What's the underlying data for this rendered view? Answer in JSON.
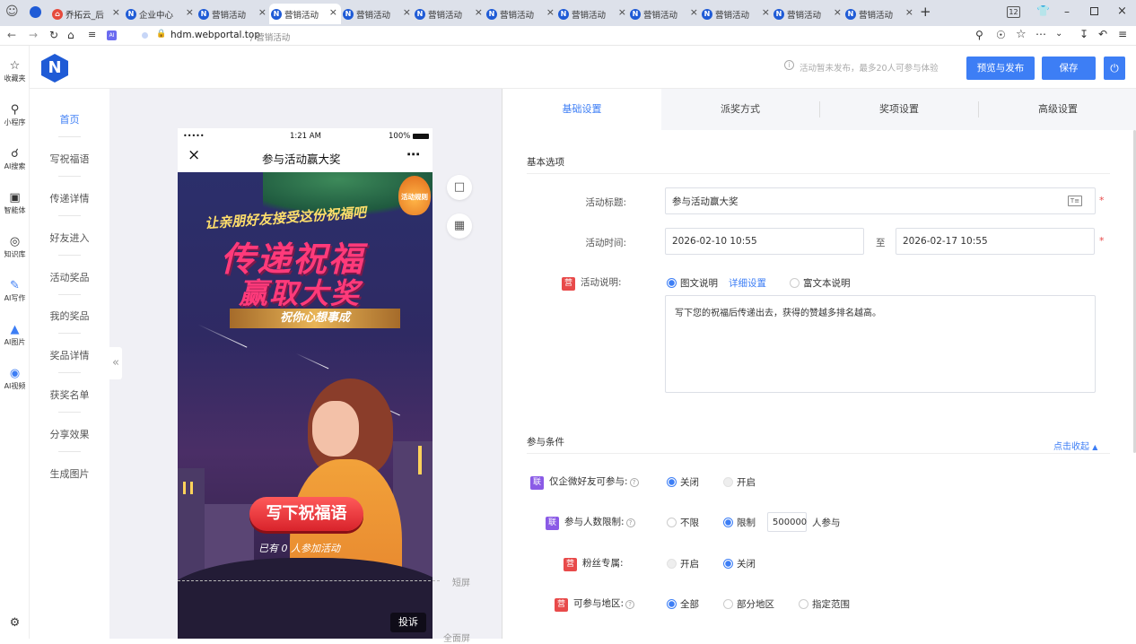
{
  "browser": {
    "tabs": [
      {
        "label": "乔拓云_后"
      },
      {
        "label": "企业中心"
      },
      {
        "label": "营销活动"
      },
      {
        "label": "营销活动"
      },
      {
        "label": "营销活动"
      },
      {
        "label": "营销活动"
      },
      {
        "label": "营销活动"
      },
      {
        "label": "营销活动"
      },
      {
        "label": "营销活动"
      },
      {
        "label": "营销活动"
      },
      {
        "label": "营销活动"
      },
      {
        "label": "营销活动"
      }
    ],
    "tab_count_badge": "12",
    "url_host": "hdm.webportal.top",
    "url_path": " / 营销活动"
  },
  "browser_sidebar": [
    {
      "icon": "star-icon",
      "label": "收藏夹"
    },
    {
      "icon": "miniprogram-icon",
      "label": "小程序"
    },
    {
      "icon": "search-icon",
      "label": "AI搜索"
    },
    {
      "icon": "agent-icon",
      "label": "智能体"
    },
    {
      "icon": "knowledge-icon",
      "label": "知识库"
    },
    {
      "icon": "ai-write-icon",
      "label": "AI写作"
    },
    {
      "icon": "ai-image-icon",
      "label": "AI图片"
    },
    {
      "icon": "ai-video-icon",
      "label": "AI视频"
    }
  ],
  "header": {
    "notice": "活动暂未发布，最多20人可参与体验",
    "preview_publish": "预览与发布",
    "save": "保存",
    "accent": "#3d7ef5"
  },
  "left_nav": [
    "首页",
    "写祝福语",
    "传递详情",
    "好友进入",
    "活动奖品",
    "我的奖品",
    "奖品详情",
    "获奖名单",
    "分享效果",
    "生成图片"
  ],
  "collapse_glyph": "«",
  "phone": {
    "carrier": "•••••",
    "time": "1:21 AM",
    "battery": "100%",
    "title": "参与活动赢大奖",
    "banner_line1": "让亲朋好友接受这份祝福吧",
    "title_line1": "传递祝福",
    "title_line2": "赢取大奖",
    "ribbon": "祝你心想事成",
    "bag_text": "活动规则",
    "cta": "写下祝福语",
    "participants": "已有 0 人参加活动",
    "complain": "投诉"
  },
  "preview_markers": {
    "short_screen": "短屏",
    "full_screen": "全面屏"
  },
  "tabs": [
    "基础设置",
    "派奖方式",
    "奖项设置",
    "高级设置"
  ],
  "basic": {
    "section_title": "基本选项",
    "title_label": "活动标题:",
    "title_value": "参与活动赢大奖",
    "time_label": "活动时间:",
    "time_start": "2026-02-10 10:55",
    "time_sep": "至",
    "time_end": "2026-02-17 10:55",
    "desc_badge": "营",
    "desc_label": "活动说明:",
    "desc_opt1": "图文说明",
    "desc_detail": "详细设置",
    "desc_opt2": "富文本说明",
    "desc_text": "写下您的祝福后传递出去，获得的赞越多排名越高。",
    "required": "*"
  },
  "conditions": {
    "section_title": "参与条件",
    "collapse": "点击收起",
    "rows": [
      {
        "badge": "联",
        "label": "仅企微好友可参与:",
        "opt1": "关闭",
        "opt2": "开启"
      },
      {
        "badge": "联",
        "label": "参与人数限制:",
        "opt1": "不限",
        "opt2": "限制",
        "limit": "500000",
        "suffix": "人参与"
      },
      {
        "badge": "营",
        "label": "粉丝专属:",
        "opt1": "开启",
        "opt2": "关闭"
      },
      {
        "badge": "营",
        "label": "可参与地区:",
        "opt1": "全部",
        "opt2": "部分地区",
        "opt3": "指定范围"
      }
    ]
  }
}
